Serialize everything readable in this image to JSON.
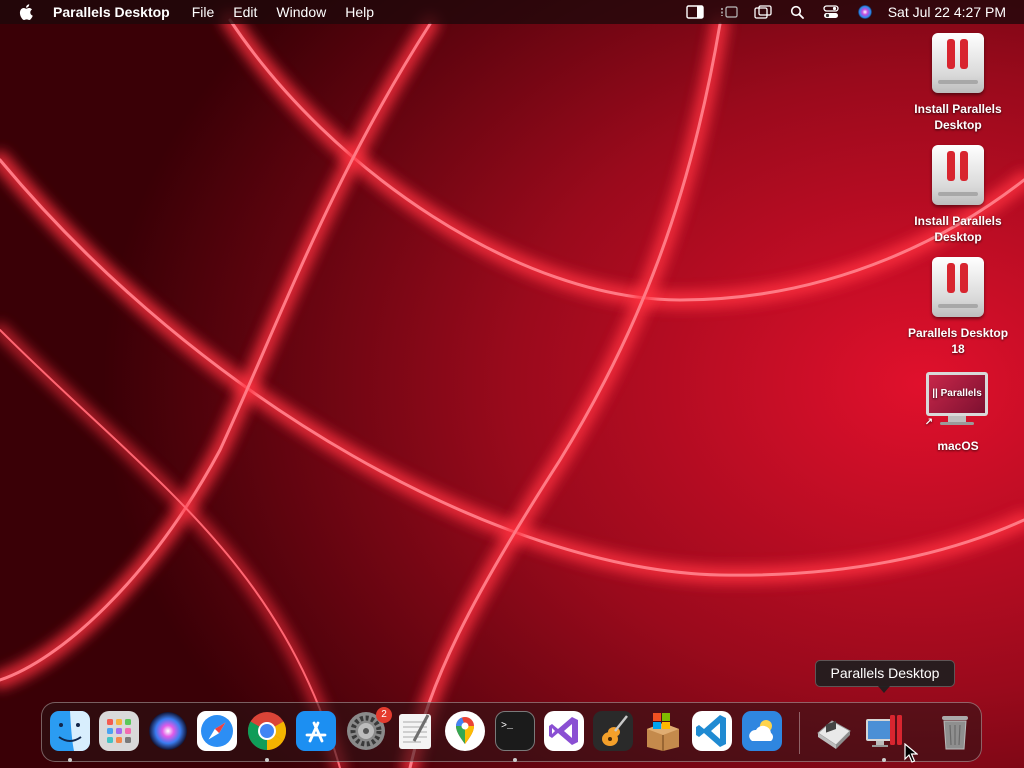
{
  "menubar": {
    "app_name": "Parallels Desktop",
    "menus": [
      "File",
      "Edit",
      "Window",
      "Help"
    ],
    "clock": "Sat Jul 22  4:27 PM",
    "status_icons": [
      "sidebar-icon",
      "stage-manager-icon",
      "display-mirroring-icon",
      "spotlight-search-icon",
      "control-center-icon",
      "siri-icon"
    ]
  },
  "desktop_icons": [
    {
      "label": "Install Parallels Desktop",
      "kind": "disk"
    },
    {
      "label": "Install Parallels Desktop",
      "kind": "disk"
    },
    {
      "label": "Parallels Desktop 18",
      "kind": "disk"
    },
    {
      "label": "macOS",
      "kind": "vm",
      "screen_text": "|| Parallels"
    }
  ],
  "tooltip": "Parallels Desktop",
  "dock": {
    "apps": [
      {
        "name": "finder",
        "running": true
      },
      {
        "name": "launchpad",
        "running": false
      },
      {
        "name": "siri",
        "running": false
      },
      {
        "name": "safari",
        "running": false
      },
      {
        "name": "chrome",
        "running": true
      },
      {
        "name": "app-store",
        "running": false
      },
      {
        "name": "system-settings",
        "running": false,
        "badge": "2"
      },
      {
        "name": "textedit",
        "running": false
      },
      {
        "name": "google-maps",
        "running": false
      },
      {
        "name": "terminal",
        "running": true
      },
      {
        "name": "visual-studio",
        "running": false
      },
      {
        "name": "garageband",
        "running": false
      },
      {
        "name": "windows-installer-package",
        "running": false
      },
      {
        "name": "vscode",
        "running": false
      },
      {
        "name": "weather",
        "running": false
      },
      {
        "name": "parallels-control-center",
        "running": false
      },
      {
        "name": "parallels-desktop",
        "running": true
      },
      {
        "name": "trash",
        "running": false
      }
    ]
  },
  "colors": {
    "wallpaper_dark": "#3a0006",
    "wallpaper_red": "#c8102e",
    "glow": "#ff4455"
  }
}
